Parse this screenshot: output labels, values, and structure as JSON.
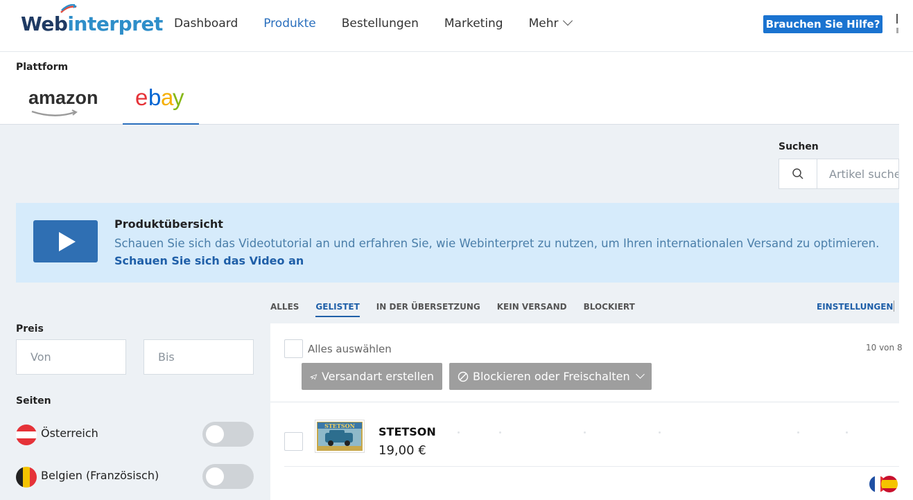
{
  "app": {
    "logo_text_a": "Web",
    "logo_text_b": "interpret",
    "brand_color": "#1f3a63",
    "accent_color": "#1a73d0"
  },
  "nav": {
    "items": [
      {
        "label": "Dashboard"
      },
      {
        "label": "Produkte"
      },
      {
        "label": "Bestellungen"
      },
      {
        "label": "Marketing"
      },
      {
        "label": "Mehr"
      }
    ],
    "help_label": "Brauchen Sie Hilfe?"
  },
  "platform": {
    "label": "Plattform",
    "tabs": {
      "amazon": "amazon",
      "ebay": [
        "e",
        "b",
        "a",
        "y"
      ]
    },
    "selected": "ebay"
  },
  "search": {
    "label": "Suchen",
    "placeholder": "Artikel suche"
  },
  "banner": {
    "title": "Produktübersicht",
    "text": "Schauen Sie sich das Videotutorial an und erfahren Sie, wie Webinterpret zu nutzen, um Ihren internationalen Versand zu optimieren.",
    "link": "Schauen Sie sich das Video an"
  },
  "filters": {
    "price_label": "Preis",
    "from_placeholder": "Von",
    "to_placeholder": "Bis",
    "sites_label": "Seiten",
    "sites": [
      {
        "name": "Österreich",
        "enabled": false
      },
      {
        "name": "Belgien (Französisch)",
        "enabled": false
      }
    ]
  },
  "status_tabs": {
    "items": [
      {
        "label": "ALLES"
      },
      {
        "label": "GELISTET"
      },
      {
        "label": "IN DER ÜBERSETZUNG"
      },
      {
        "label": "KEIN VERSAND"
      },
      {
        "label": "BLOCKIERT"
      }
    ],
    "selected": "GELISTET",
    "settings": "EINSTELLUNGEN"
  },
  "list": {
    "select_all": "Alles auswählen",
    "count": "10 von 8",
    "actions": {
      "shipping": "Versandart erstellen",
      "block": "Blockieren oder Freischalten"
    },
    "products": [
      {
        "name": "STETSON",
        "price": "19,00 €",
        "thumb_text": "STETSON"
      }
    ]
  }
}
